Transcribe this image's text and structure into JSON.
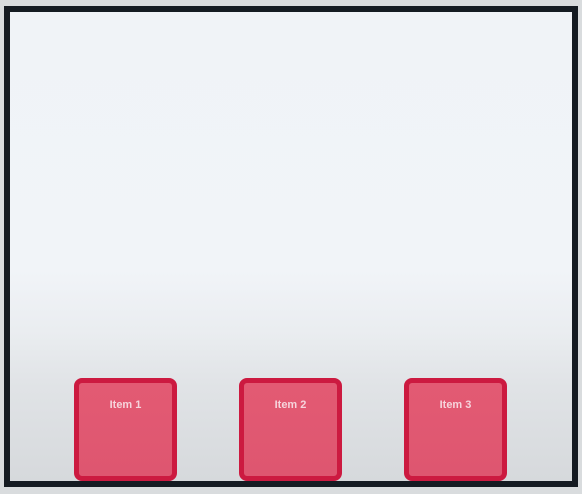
{
  "items": [
    {
      "label": "Item 1"
    },
    {
      "label": "Item 2"
    },
    {
      "label": "Item 3"
    }
  ],
  "colors": {
    "container_border": "#151b22",
    "item_fill": "#e05871",
    "item_border": "#cc1a40",
    "item_text": "#f6d4dc"
  }
}
